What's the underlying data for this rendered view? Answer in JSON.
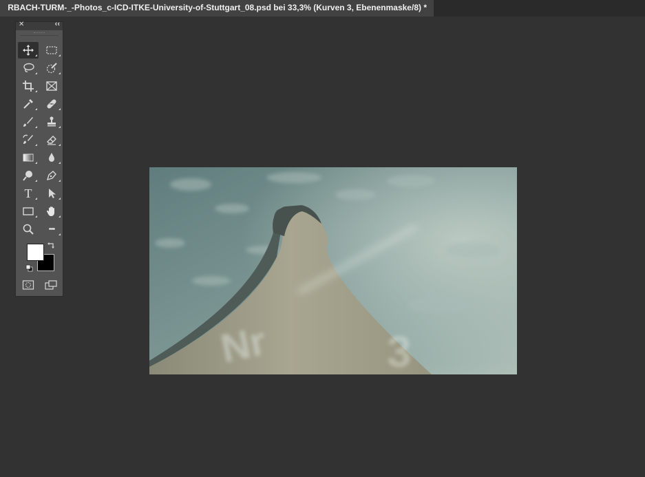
{
  "document_tab": {
    "title": "RBACH-TURM-_-Photos_c-ICD-ITKE-University-of-Stuttgart_08.psd bei 33,3% (Kurven 3, Ebenenmaske/8) *"
  },
  "toolbar": {
    "tools": [
      {
        "name": "move-tool",
        "icon": "move-icon",
        "active": true
      },
      {
        "name": "marquee-tool",
        "icon": "rectangular-marquee-icon"
      },
      {
        "name": "lasso-tool",
        "icon": "lasso-icon"
      },
      {
        "name": "quick-selection-tool",
        "icon": "quick-selection-icon"
      },
      {
        "name": "crop-tool",
        "icon": "crop-icon"
      },
      {
        "name": "frame-tool",
        "icon": "frame-icon"
      },
      {
        "name": "eyedropper-tool",
        "icon": "eyedropper-icon"
      },
      {
        "name": "healing-brush-tool",
        "icon": "bandage-icon"
      },
      {
        "name": "brush-tool",
        "icon": "brush-icon"
      },
      {
        "name": "clone-stamp-tool",
        "icon": "stamp-icon"
      },
      {
        "name": "history-brush-tool",
        "icon": "history-brush-icon"
      },
      {
        "name": "eraser-tool",
        "icon": "eraser-icon"
      },
      {
        "name": "gradient-tool",
        "icon": "gradient-icon"
      },
      {
        "name": "blur-tool",
        "icon": "drop-icon"
      },
      {
        "name": "dodge-tool",
        "icon": "dodge-icon"
      },
      {
        "name": "pen-tool",
        "icon": "pen-icon"
      },
      {
        "name": "type-tool",
        "icon": "type-icon",
        "glyph": "T"
      },
      {
        "name": "path-selection-tool",
        "icon": "arrow-icon"
      },
      {
        "name": "rectangle-tool",
        "icon": "rectangle-icon"
      },
      {
        "name": "hand-tool",
        "icon": "hand-icon"
      },
      {
        "name": "zoom-tool",
        "icon": "magnifier-icon"
      },
      {
        "name": "more-tools",
        "icon": "more-icon",
        "glyph": "•••"
      }
    ],
    "foreground_color": "#ffffff",
    "background_color": "#000000"
  },
  "canvas": {
    "colors": {
      "sky_top": "#5f7a7a",
      "sky_bottom": "#a9bcb6",
      "tower": "#9e9c88",
      "tower_shadow": "#5b6660"
    },
    "painted_text": [
      "Nr",
      "3"
    ]
  }
}
